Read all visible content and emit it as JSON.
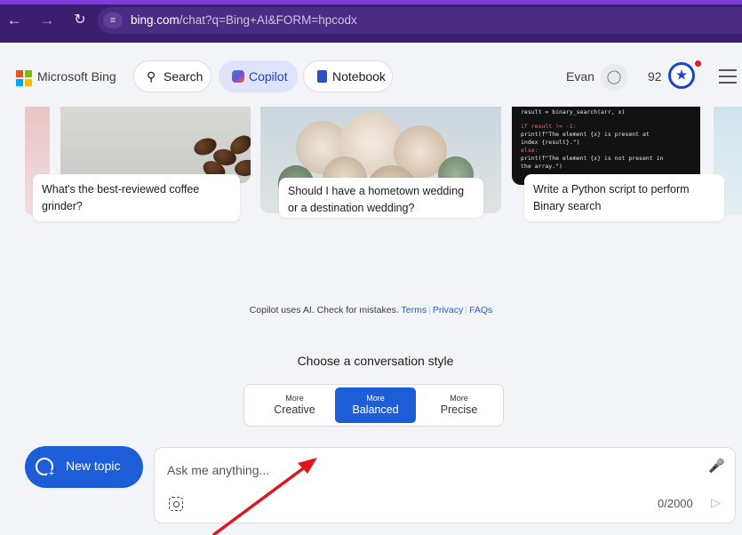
{
  "browser": {
    "url_host": "bing.com",
    "url_path": "/chat?q=Bing+AI&FORM=hpcodx",
    "back_icon": "arrow-left-icon",
    "forward_icon": "arrow-right-icon",
    "reload_icon": "reload-icon",
    "site_info_icon": "tune-icon"
  },
  "header": {
    "brand": "Microsoft Bing",
    "tabs": [
      {
        "label": "Search",
        "icon": "search-icon"
      },
      {
        "label": "Copilot",
        "icon": "copilot-icon",
        "active": true
      },
      {
        "label": "Notebook",
        "icon": "notebook-icon"
      }
    ],
    "user_name": "Evan",
    "points": "92"
  },
  "suggestions": [
    {
      "text": "What's the best-reviewed coffee grinder?"
    },
    {
      "text": "Should I have a hometown wedding or a destination wedding?"
    },
    {
      "text": "Write a Python script to perform Binary search"
    }
  ],
  "code_snippet": [
    "result = binary_search(arr, x)",
    "if result != -1:",
    "    print(f\"The element {x} is present at",
    "index {result}.\")",
    "else:",
    "    print(f\"The element {x} is not present in",
    "the array.\")"
  ],
  "disclaimer": {
    "text": "Copilot uses AI. Check for mistakes.",
    "links": [
      "Terms",
      "Privacy",
      "FAQs"
    ]
  },
  "conversation_style": {
    "title": "Choose a conversation style",
    "options": [
      {
        "top": "More",
        "bottom": "Creative"
      },
      {
        "top": "More",
        "bottom": "Balanced",
        "selected": true
      },
      {
        "top": "More",
        "bottom": "Precise"
      }
    ]
  },
  "composer": {
    "new_topic_label": "New topic",
    "placeholder": "Ask me anything...",
    "counter": "0/2000"
  },
  "colors": {
    "accent": "#1d5ed8",
    "chrome": "#3b1f6e",
    "annotation_arrow": "#e0161e"
  }
}
